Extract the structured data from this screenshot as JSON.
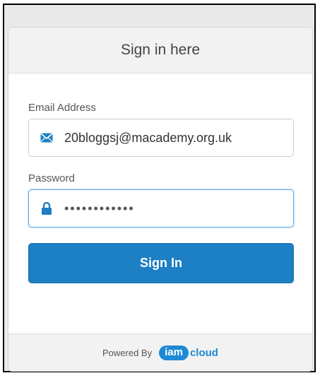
{
  "header": {
    "title": "Sign in here"
  },
  "email": {
    "label": "Email Address",
    "value": "20bloggsj@macademy.org.uk",
    "icon": "envelope-icon"
  },
  "password": {
    "label": "Password",
    "masked_value": "••••••••••••",
    "icon": "lock-icon"
  },
  "signin": {
    "label": "Sign In"
  },
  "footer": {
    "powered_by": "Powered By",
    "logo_part1": "iam",
    "logo_part2": "cloud"
  },
  "colors": {
    "primary": "#1d7fc4",
    "focus_border": "#5ea7e3",
    "logo": "#1d8ad3"
  }
}
